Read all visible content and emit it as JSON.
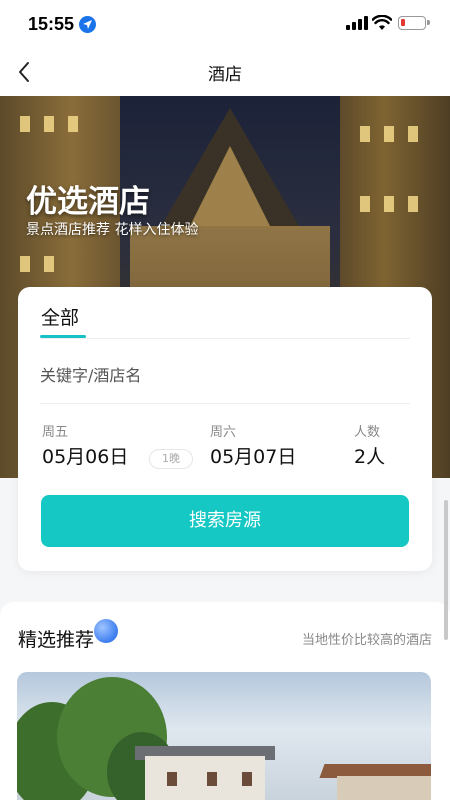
{
  "status_bar": {
    "time": "15:55"
  },
  "nav": {
    "title": "酒店"
  },
  "hero": {
    "title": "优选酒店",
    "subtitle": "景点酒店推荐 花样入住体验"
  },
  "search": {
    "tab_label": "全部",
    "keyword_placeholder": "关键字/酒店名",
    "checkin_day": "周五",
    "checkin_date": "05月06日",
    "nights": "1晚",
    "checkout_day": "周六",
    "checkout_date": "05月07日",
    "guests_label": "人数",
    "guests_value": "2人",
    "button_label": "搜索房源"
  },
  "recommend": {
    "title": "精选推荐",
    "subtitle": "当地性价比较高的酒店"
  },
  "colors": {
    "accent": "#16c8c4",
    "low_battery": "#e53935",
    "location": "#1a73e8"
  }
}
